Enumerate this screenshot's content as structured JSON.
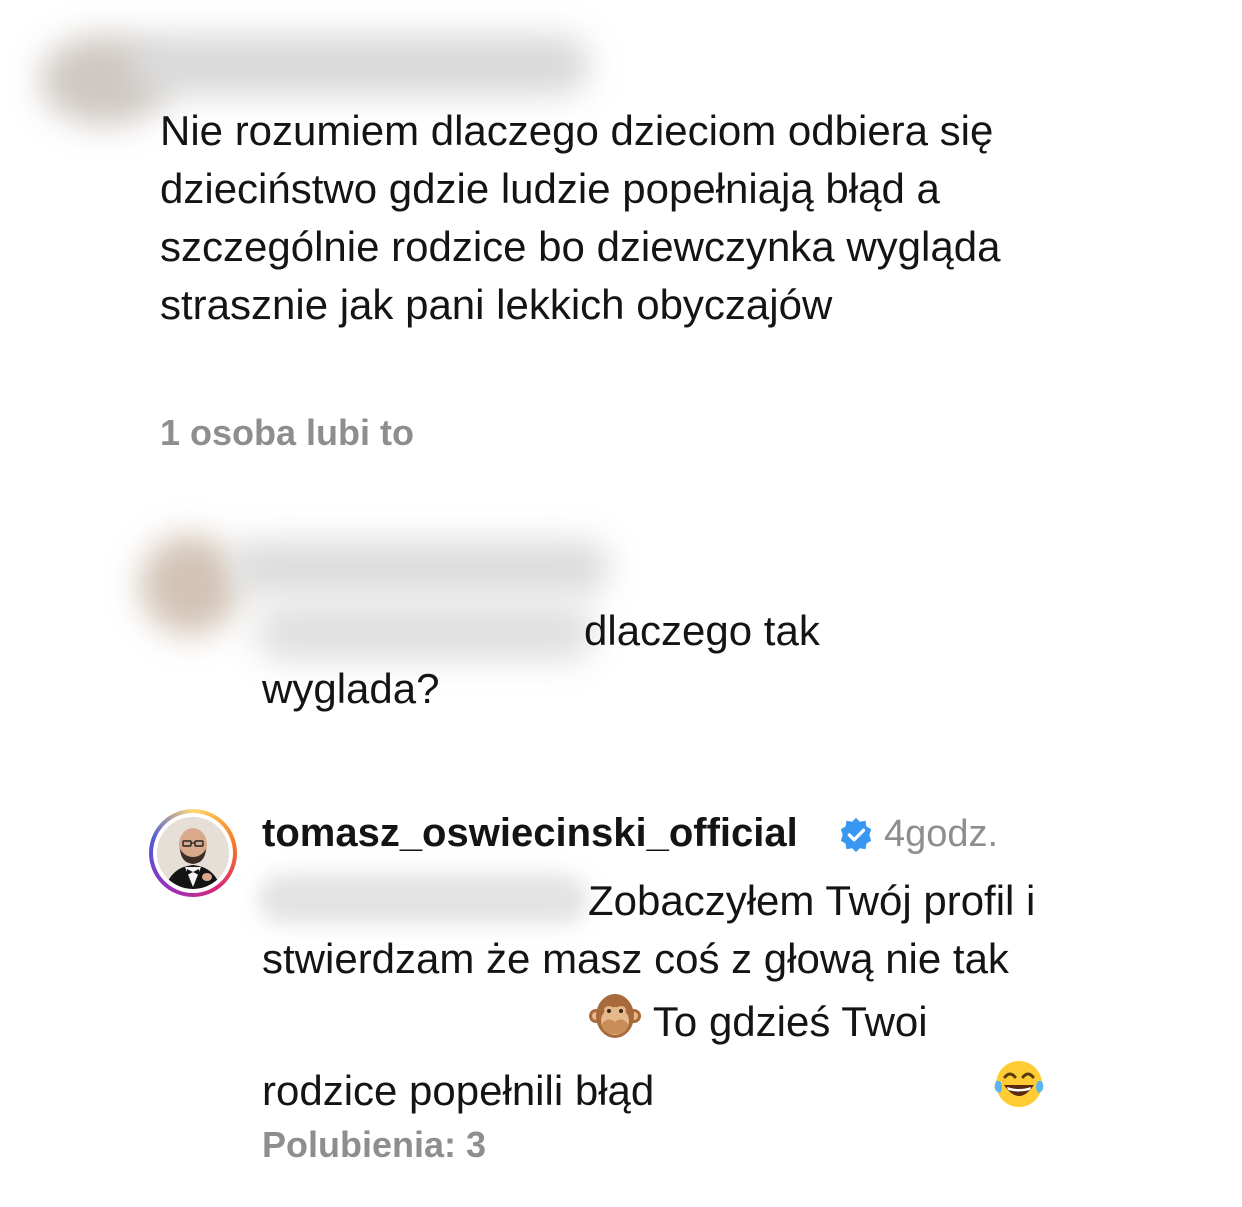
{
  "comments": [
    {
      "text": "Nie rozumiem dlaczego dzieciom odbiera się dzieciństwo gdzie ludzie popełniają błąd a szczególnie rodzice bo dziewczynka wygląda strasznie jak pani lekkich obyczajów",
      "likes": "1 osoba lubi to"
    },
    {
      "text_after_mention": "dlaczego tak wyglada?"
    },
    {
      "username": "tomasz_oswiecinski_official",
      "time": "4godz.",
      "text_part1": "Zobaczyłem Twój profil i stwierdzam że masz coś z głową nie tak",
      "text_part2": "To gdzieś Twoi rodzice popełnili błąd",
      "likes": "Polubienia: 3",
      "verified_icon": "verified-badge-icon",
      "emoji1": "see-no-evil-monkey-emoji",
      "emoji2": "tears-of-joy-emoji"
    }
  ],
  "colors": {
    "verified": "#3897f0",
    "meta_gray": "#8e8e8e"
  }
}
